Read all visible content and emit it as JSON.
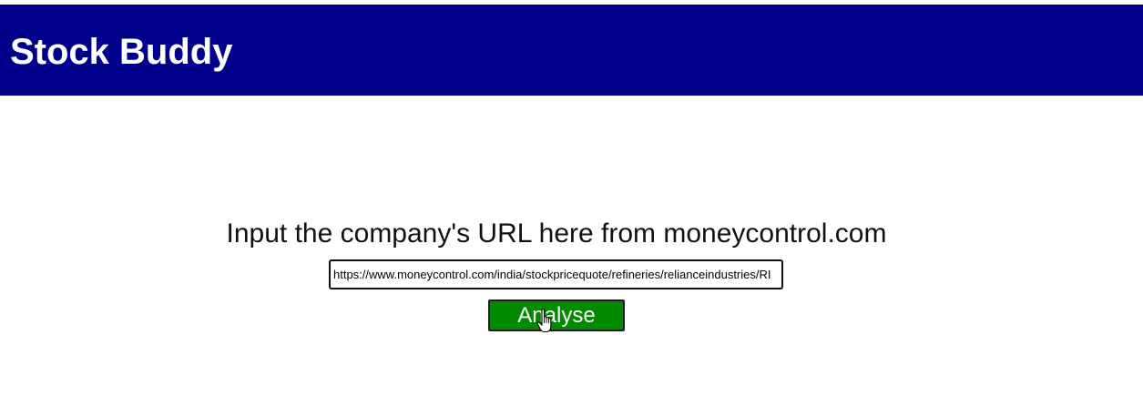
{
  "header": {
    "title": "Stock Buddy",
    "background_color": "#00008b"
  },
  "main": {
    "prompt": "Input the company's URL here from moneycontrol.com",
    "url_input": {
      "value": "https://www.moneycontrol.com/india/stockpricequote/refineries/relianceindustries/RI"
    },
    "analyse_button": {
      "label": "Analyse",
      "color": "#008a00"
    },
    "cursor_icon": "hand-pointer-icon"
  }
}
